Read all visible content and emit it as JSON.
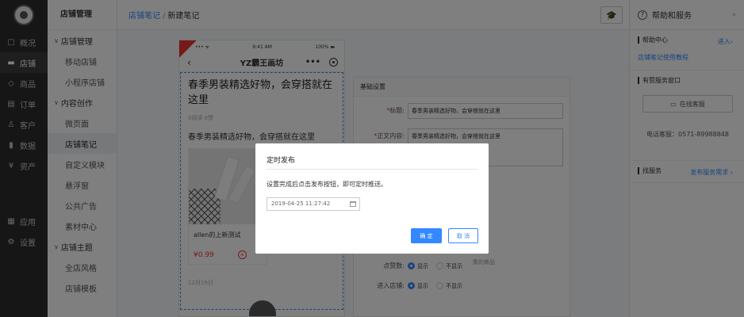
{
  "rail": {
    "items": [
      {
        "icon": "▢",
        "label": "概况"
      },
      {
        "icon": "▬",
        "label": "店铺"
      },
      {
        "icon": "◇",
        "label": "商品"
      },
      {
        "icon": "▤",
        "label": "订单"
      },
      {
        "icon": "♙",
        "label": "客户"
      },
      {
        "icon": "▮",
        "label": "数据"
      },
      {
        "icon": "¥",
        "label": "资产"
      }
    ],
    "bottom": [
      {
        "icon": "▦",
        "label": "应用"
      },
      {
        "icon": "⚙",
        "label": "设置"
      }
    ]
  },
  "side": {
    "title": "店铺管理",
    "group1": "店铺管理",
    "group1_items": [
      "移动店铺",
      "小程序店铺"
    ],
    "group2": "内容创作",
    "group2_items": [
      "微页面",
      "店铺笔记",
      "自定义模块",
      "悬浮窗",
      "公共广告",
      "素材中心"
    ],
    "group3": "店铺主题",
    "group3_items": [
      "全店风格",
      "店铺模板"
    ]
  },
  "breadcrumb": {
    "link": "店铺笔记",
    "sep": "/",
    "current": "新建笔记"
  },
  "help": {
    "title": "帮助和服务",
    "center": {
      "title": "帮助中心",
      "more": "进入›",
      "link": "店铺笔记使用教程"
    },
    "service": {
      "title": "有赞服务窗口",
      "button": "在线客服",
      "phone": "电话客服：0571-89988848"
    },
    "find": {
      "title": "找服务",
      "more": "发布服务需求 ›"
    }
  },
  "preview": {
    "time": "9:41 AM",
    "battery": "100%",
    "signal": "••• ᯤ",
    "shop_name": "YZ霸王画坊",
    "title": "春季男装精选好物，会穿搭就在这里",
    "meta": "0阅读   0赞",
    "text": "春季男装精选好物，会穿搭就在这里",
    "goods_name": "allen的上新测试",
    "price": "¥0.99",
    "date": "12月19日"
  },
  "settings": {
    "header": "基础设置",
    "title_label": "标题:",
    "title_value": "春季男装精选好物，会穿搭就在这里",
    "body_label": "正文内容:",
    "body_value": "春季男装精选好物，会穿搭就在这里",
    "hint": "集的商品",
    "like_label": "点赞数:",
    "enter_label": "进入店铺:",
    "show": "显示",
    "hide": "不显示"
  },
  "modal": {
    "title": "定时发布",
    "message": "设置完成后点击发布按钮，即可定时推送。",
    "date": "2019-04-25 11:27:42",
    "ok": "确 定",
    "cancel": "取 消"
  },
  "colors": {
    "accent": "#3388ff",
    "sidebar": "#2d2d2d",
    "price": "#ee3333"
  }
}
